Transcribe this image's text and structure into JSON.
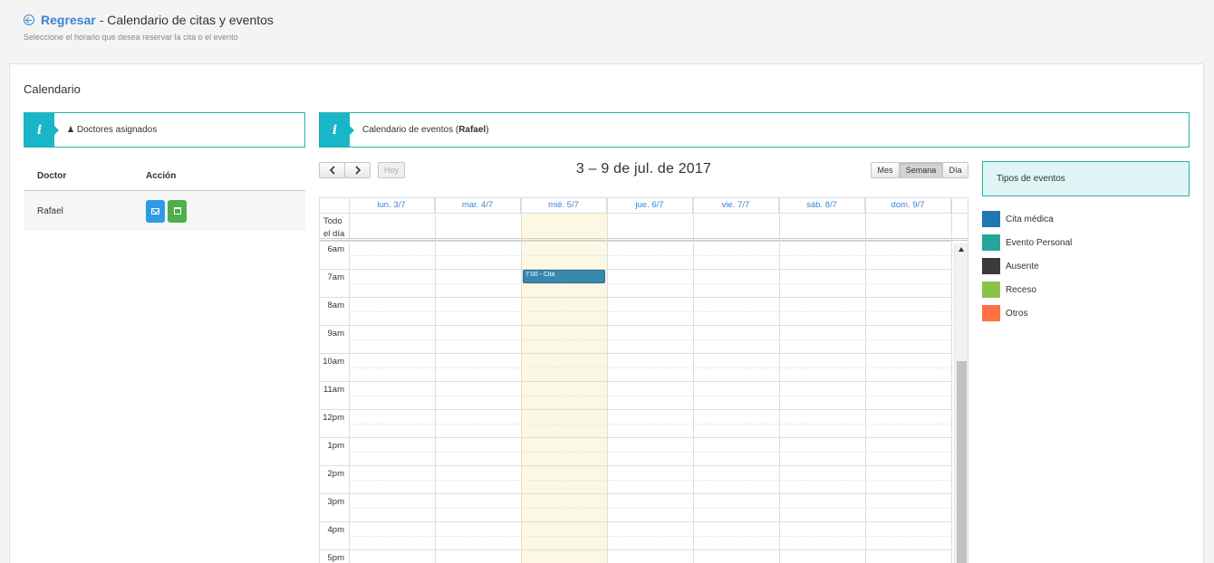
{
  "header": {
    "back_label": "Regresar",
    "title_suffix": "- Calendario de citas y eventos",
    "subtitle": "Seleccione el horario que desea reservar la cita o el evento"
  },
  "card": {
    "title": "Calendario"
  },
  "doctors_panel": {
    "info_label": "Doctores asignados",
    "col_doctor": "Doctor",
    "col_action": "Acción",
    "rows": [
      {
        "name": "Rafael"
      }
    ]
  },
  "calendar_panel": {
    "info_prefix": "Calendario de eventos (",
    "info_doctor": "Rafael",
    "info_suffix": ")"
  },
  "calendar": {
    "title": "3 – 9 de jul. de 2017",
    "today_label": "Hoy",
    "view_month": "Mes",
    "view_week": "Semana",
    "view_day": "Día",
    "active_view": "Semana",
    "allday_label_1": "Todo",
    "allday_label_2": "el día",
    "days": [
      "lun. 3/7",
      "mar. 4/7",
      "mié. 5/7",
      "jue. 6/7",
      "vie. 7/7",
      "sáb. 8/7",
      "dom. 9/7"
    ],
    "today_index": 2,
    "hours": [
      "6am",
      "7am",
      "8am",
      "9am",
      "10am",
      "11am",
      "12pm",
      "1pm",
      "2pm",
      "3pm",
      "4pm",
      "5pm"
    ],
    "events": [
      {
        "label": "7:00 - Cita",
        "day_index": 2,
        "start_hour": "7am"
      }
    ]
  },
  "legend": {
    "title": "Tipos de eventos",
    "items": [
      {
        "label": "Cita médica",
        "color": "#1f77b4"
      },
      {
        "label": "Evento Personal",
        "color": "#26a69a"
      },
      {
        "label": "Ausente",
        "color": "#3a3a3a"
      },
      {
        "label": "Receso",
        "color": "#8bc34a"
      },
      {
        "label": "Otros",
        "color": "#ff7043"
      }
    ]
  },
  "colors": {
    "accent": "#3a87cf",
    "info_icon": "#19b6c9",
    "event": "#3a87ad",
    "today": "#fcf8e3"
  }
}
